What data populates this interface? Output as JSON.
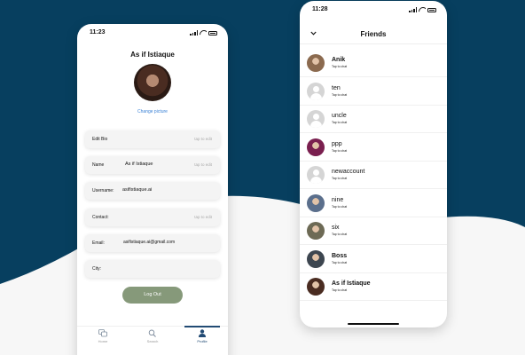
{
  "colors": {
    "background_dark": "#073f5f",
    "background_light": "#ffffff",
    "accent": "#3b82d6",
    "logout": "#86997a",
    "tab_active": "#224b74"
  },
  "profile": {
    "status_time": "11:23",
    "title": "As if Istiaque",
    "change_picture": "Change picture",
    "fields": {
      "bio": {
        "label": "Edit Bio",
        "hint": "tap to edit"
      },
      "name": {
        "label": "Name",
        "value": "As if Istiaque",
        "hint": "tap to edit"
      },
      "username": {
        "label": "Username:",
        "value": "asifistiaque.ai"
      },
      "contact": {
        "label": "Contact:",
        "hint": "tap to edit"
      },
      "email": {
        "label": "Email:",
        "value": "asifistiaque.ai@gmail.com"
      },
      "city": {
        "label": "City:"
      }
    },
    "logout": "Log Out",
    "tabs": {
      "home": "Home",
      "search": "Search",
      "profile": "Profile"
    }
  },
  "friends": {
    "status_time": "11:28",
    "title": "Friends",
    "tap_to_chat": "Tap to chat",
    "list": [
      {
        "name": "Anik",
        "bold": true,
        "avatar": "photo",
        "color": "#8b6a4f"
      },
      {
        "name": "ten",
        "bold": false,
        "avatar": "generic"
      },
      {
        "name": "uncle",
        "bold": false,
        "avatar": "generic"
      },
      {
        "name": "ppp",
        "bold": false,
        "avatar": "photo",
        "color": "#7a1f4f"
      },
      {
        "name": "newaccount",
        "bold": false,
        "avatar": "generic"
      },
      {
        "name": "nine",
        "bold": false,
        "avatar": "photo",
        "color": "#5b6f8c"
      },
      {
        "name": "six",
        "bold": false,
        "avatar": "photo",
        "color": "#6d6a55"
      },
      {
        "name": "Boss",
        "bold": true,
        "avatar": "photo",
        "color": "#3d4650"
      },
      {
        "name": "As if Istiaque",
        "bold": true,
        "avatar": "photo",
        "color": "#4a2c21"
      }
    ]
  }
}
